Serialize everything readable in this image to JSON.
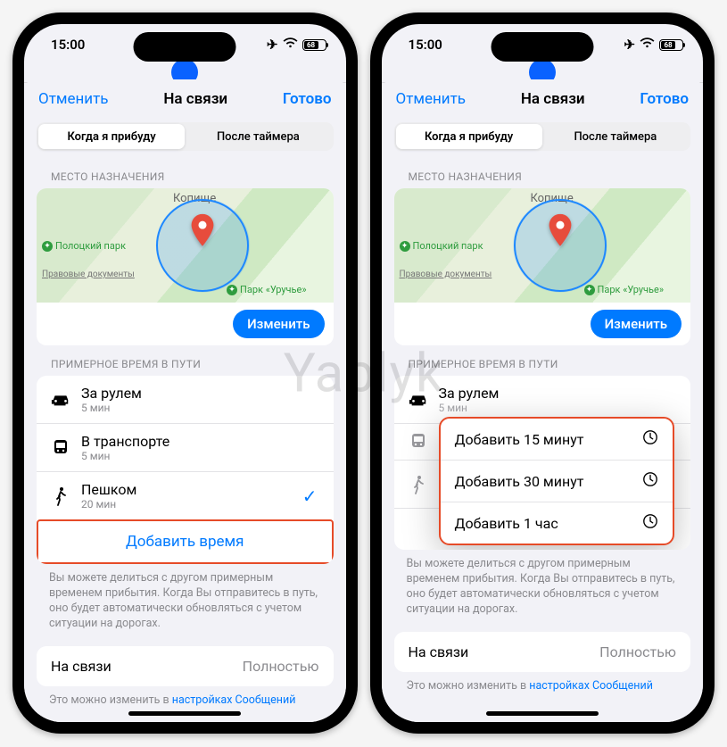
{
  "watermark": "Yablyk",
  "status": {
    "time": "15:00",
    "battery": "68"
  },
  "peek_title": "",
  "modal": {
    "cancel": "Отменить",
    "title": "На связи",
    "done": "Готово"
  },
  "segments": {
    "arrive": "Когда я прибуду",
    "timer": "После таймера"
  },
  "destination": {
    "section": "МЕСТО НАЗНАЧЕНИЯ",
    "city": "Копище",
    "park1": "Полоцкий парк",
    "park2": "Парк «Уручье»",
    "legal": "Правовые документы",
    "change": "Изменить"
  },
  "travel": {
    "section": "ПРИМЕРНОЕ ВРЕМЯ В ПУТИ",
    "drive": {
      "label": "За рулем",
      "sub": "5 мин"
    },
    "transit": {
      "label": "В транспорте",
      "sub": "5 мин"
    },
    "walk": {
      "label": "Пешком",
      "sub": "20 мин"
    },
    "addtime": "Добавить время",
    "hint": "Вы можете делиться с другом примерным временем прибытия. Когда Вы отправитесь в путь, оно будет автоматически обновляться с учетом ситуации на дорогах."
  },
  "popup": {
    "opt1": "Добавить 15 минут",
    "opt2": "Добавить 30 минут",
    "opt3": "Добавить 1 час"
  },
  "bottom": {
    "left": "На связи",
    "right": "Полностью",
    "hint_pre": "Это можно изменить в ",
    "hint_link": "настройках Сообщений"
  }
}
